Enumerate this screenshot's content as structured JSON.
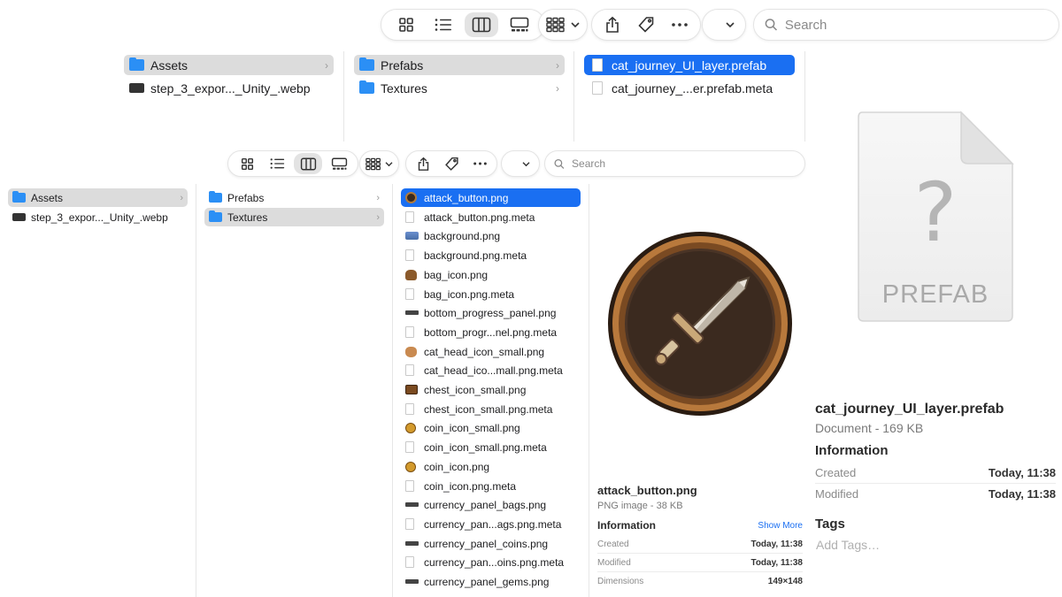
{
  "toolbar_top": {
    "search_placeholder": "Search"
  },
  "toolbar_mid": {
    "search_placeholder": "Search"
  },
  "top_finder": {
    "col1": [
      {
        "label": "Assets",
        "icon": "folder-icon"
      },
      {
        "label": "step_3_expor..._Unity_.webp",
        "icon": "image-file-icon"
      }
    ],
    "col2": [
      {
        "label": "Prefabs",
        "icon": "folder-icon"
      },
      {
        "label": "Textures",
        "icon": "folder-icon"
      }
    ],
    "col3": [
      {
        "label": "cat_journey_UI_layer.prefab",
        "icon": "document-icon"
      },
      {
        "label": "cat_journey_...er.prefab.meta",
        "icon": "document-icon"
      }
    ]
  },
  "bottom_finder": {
    "col1": [
      {
        "label": "Assets",
        "icon": "folder-icon"
      },
      {
        "label": "step_3_expor..._Unity_.webp",
        "icon": "image-file-icon"
      }
    ],
    "col2": [
      {
        "label": "Prefabs",
        "icon": "folder-icon"
      },
      {
        "label": "Textures",
        "icon": "folder-icon"
      }
    ],
    "files": [
      {
        "label": "attack_button.png",
        "icon": "attack"
      },
      {
        "label": "attack_button.png.meta",
        "icon": "doc"
      },
      {
        "label": "background.png",
        "icon": "bg"
      },
      {
        "label": "background.png.meta",
        "icon": "doc"
      },
      {
        "label": "bag_icon.png",
        "icon": "bag"
      },
      {
        "label": "bag_icon.png.meta",
        "icon": "doc"
      },
      {
        "label": "bottom_progress_panel.png",
        "icon": "bar"
      },
      {
        "label": "bottom_progr...nel.png.meta",
        "icon": "doc"
      },
      {
        "label": "cat_head_icon_small.png",
        "icon": "cat"
      },
      {
        "label": "cat_head_ico...mall.png.meta",
        "icon": "doc"
      },
      {
        "label": "chest_icon_small.png",
        "icon": "chest"
      },
      {
        "label": "chest_icon_small.png.meta",
        "icon": "doc"
      },
      {
        "label": "coin_icon_small.png",
        "icon": "coin"
      },
      {
        "label": "coin_icon_small.png.meta",
        "icon": "doc"
      },
      {
        "label": "coin_icon.png",
        "icon": "coin"
      },
      {
        "label": "coin_icon.png.meta",
        "icon": "doc"
      },
      {
        "label": "currency_panel_bags.png",
        "icon": "bar"
      },
      {
        "label": "currency_pan...ags.png.meta",
        "icon": "doc"
      },
      {
        "label": "currency_panel_coins.png",
        "icon": "bar"
      },
      {
        "label": "currency_pan...oins.png.meta",
        "icon": "doc"
      },
      {
        "label": "currency_panel_gems.png",
        "icon": "bar"
      }
    ]
  },
  "preview_bottom": {
    "name": "attack_button.png",
    "kind": "PNG image - 38 KB",
    "info_heading": "Information",
    "show_more": "Show More",
    "rows": [
      {
        "label": "Created",
        "value": "Today, 11:38"
      },
      {
        "label": "Modified",
        "value": "Today, 11:38"
      },
      {
        "label": "Dimensions",
        "value": "149×148"
      }
    ]
  },
  "preview_top": {
    "icon_text": "PREFAB",
    "icon_glyph": "?",
    "name": "cat_journey_UI_layer.prefab",
    "kind": "Document - 169 KB",
    "info_heading": "Information",
    "rows": [
      {
        "label": "Created",
        "value": "Today, 11:38"
      },
      {
        "label": "Modified",
        "value": "Today, 11:38"
      }
    ],
    "tags_heading": "Tags",
    "tags_placeholder": "Add Tags…"
  }
}
